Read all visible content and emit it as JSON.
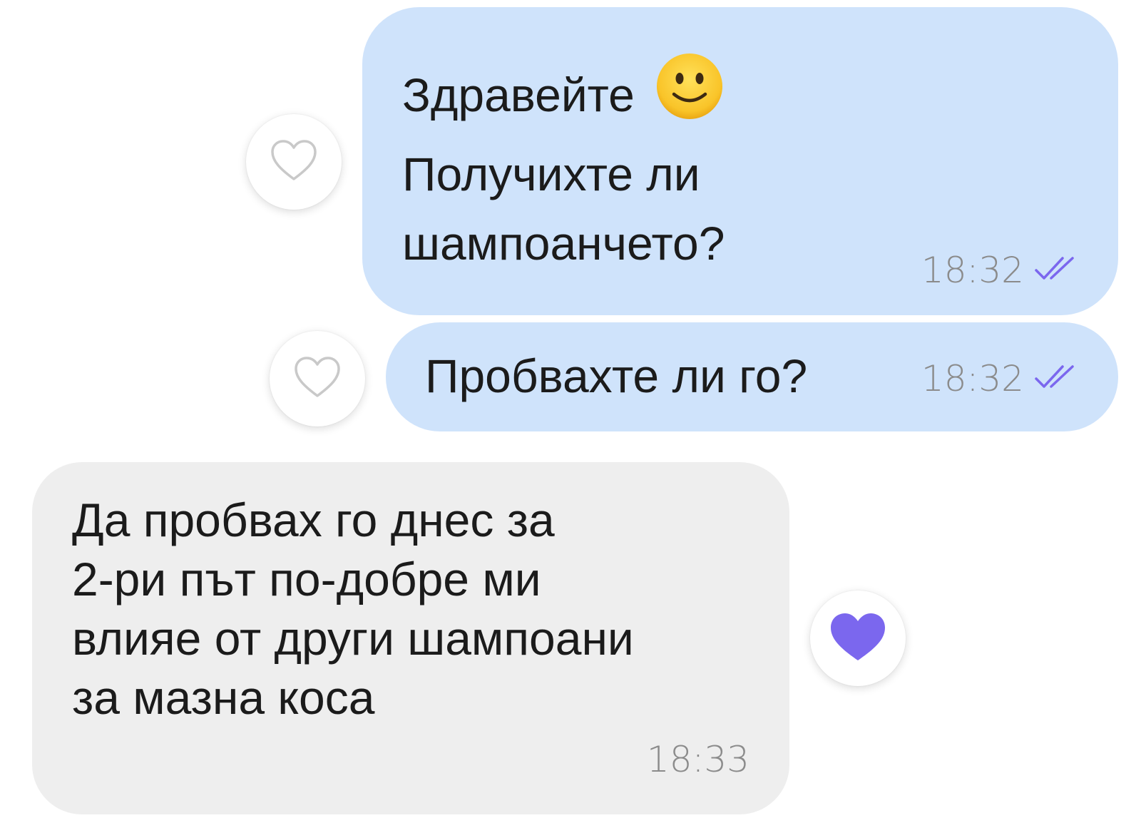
{
  "messages": [
    {
      "direction": "outgoing",
      "lines": [
        "Здравейте",
        "Получихте ли",
        "шампоанчето?"
      ],
      "emoji": "slightly-smiling-face",
      "time": "18:32",
      "status": "read",
      "reaction": "none"
    },
    {
      "direction": "outgoing",
      "lines": [
        "Пробвахте ли го?"
      ],
      "time": "18:32",
      "status": "read",
      "reaction": "none"
    },
    {
      "direction": "incoming",
      "lines": [
        "Да пробвах го днес за",
        "2-ри път по-добре ми",
        "влияе от други шампоани",
        "за мазна коса"
      ],
      "time": "18:33",
      "reaction": "heart"
    }
  ],
  "colors": {
    "outgoing_bubble": "#cfe3fb",
    "incoming_bubble": "#eeeeee",
    "read_checks": "#7b67ee",
    "heart_filled": "#7b67ee",
    "timestamp": "#8b8b8b"
  },
  "icons": {
    "reaction_empty": "heart-outline-icon",
    "reaction_filled": "heart-filled-icon",
    "read_status": "double-check-icon",
    "emoji": "slightly-smiling-face-icon"
  }
}
